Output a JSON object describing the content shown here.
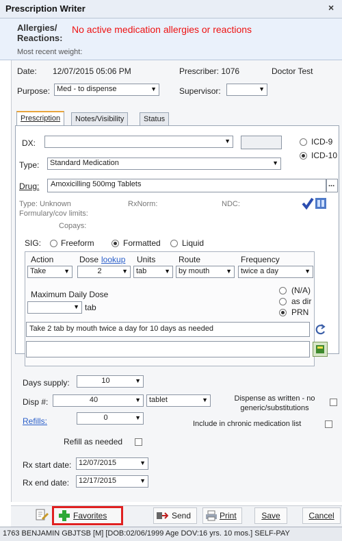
{
  "window": {
    "title": "Prescription Writer",
    "close_label": "×"
  },
  "patient_info": {
    "allergies_label": "Allergies/ Reactions:",
    "allergies_value": "No active medication allergies or reactions",
    "weight_label": "Most recent weight:"
  },
  "header": {
    "date_label": "Date:",
    "date_value": "12/07/2015 05:06 PM",
    "prescriber_label": "Prescriber: 1076",
    "doctor": "Doctor Test",
    "purpose_label": "Purpose:",
    "purpose_value": "Med - to dispense",
    "supervisor_label": "Supervisor:",
    "supervisor_value": ""
  },
  "tabs": [
    {
      "label": "Prescription",
      "active": true
    },
    {
      "label": "Notes/Visibility",
      "active": false
    },
    {
      "label": "Status",
      "active": false
    }
  ],
  "prescription": {
    "dx_label": "DX:",
    "dx_value": "",
    "icd9_label": "ICD-9",
    "icd10_label": "ICD-10",
    "icd_selected": "ICD-10",
    "type_label": "Type:",
    "type_value": "Standard Medication",
    "drug_label": "Drug:",
    "drug_value": "Amoxicilling 500mg Tablets",
    "drug_more": "...",
    "drug_type": "Type: Unknown",
    "rxnorm": "RxNorm:",
    "ndc": "NDC:",
    "formulary": "Formulary/cov limits:",
    "copays": "Copays:",
    "sig_label": "SIG:",
    "sig_options": [
      "Freeform",
      "Formatted",
      "Liquid"
    ],
    "sig_selected": "Formatted",
    "columns": {
      "action": "Action",
      "dose": "Dose",
      "dose_lookup": "lookup",
      "units": "Units",
      "route": "Route",
      "frequency": "Frequency"
    },
    "action_value": "Take",
    "dose_value": "2",
    "units_value": "tab",
    "route_value": "by mouth",
    "frequency_value": "twice a day",
    "max_daily_label": "Maximum Daily Dose",
    "max_daily_value": "",
    "max_daily_unit": "tab",
    "prn_options": [
      "(N/A)",
      "as dir",
      "PRN"
    ],
    "prn_selected": "PRN",
    "sig_text": "Take 2 tab by mouth twice a day for 10 days as needed",
    "sig_text2": ""
  },
  "dispense": {
    "days_supply_label": "Days supply:",
    "days_supply_value": "10",
    "disp_label": "Disp #:",
    "disp_value": "40",
    "disp_unit": "tablet",
    "daw_label": "Dispense as written - no generic/substitutions",
    "refills_label": "Refills:",
    "refills_value": "0",
    "chronic_label": "Include in chronic medication list",
    "refill_needed_label": "Refill as needed",
    "rx_start_label": "Rx start date:",
    "rx_start_value": "12/07/2015",
    "rx_end_label": "Rx end date:",
    "rx_end_value": "12/17/2015"
  },
  "buttons": {
    "favorites": "Favorites",
    "send": "Send",
    "print": "Print",
    "save": "Save",
    "cancel": "Cancel"
  },
  "status_bar": {
    "text": "1763 BENJAMIN GBJTSB [M] [DOB:02/06/1999 Age DOV:16 yrs. 10 mos.] SELF-PAY"
  },
  "colors": {
    "alert": "#e11111",
    "highlight_box": "#e02020",
    "link": "#2a5ec9",
    "tab_accent": "#e8a43b"
  }
}
